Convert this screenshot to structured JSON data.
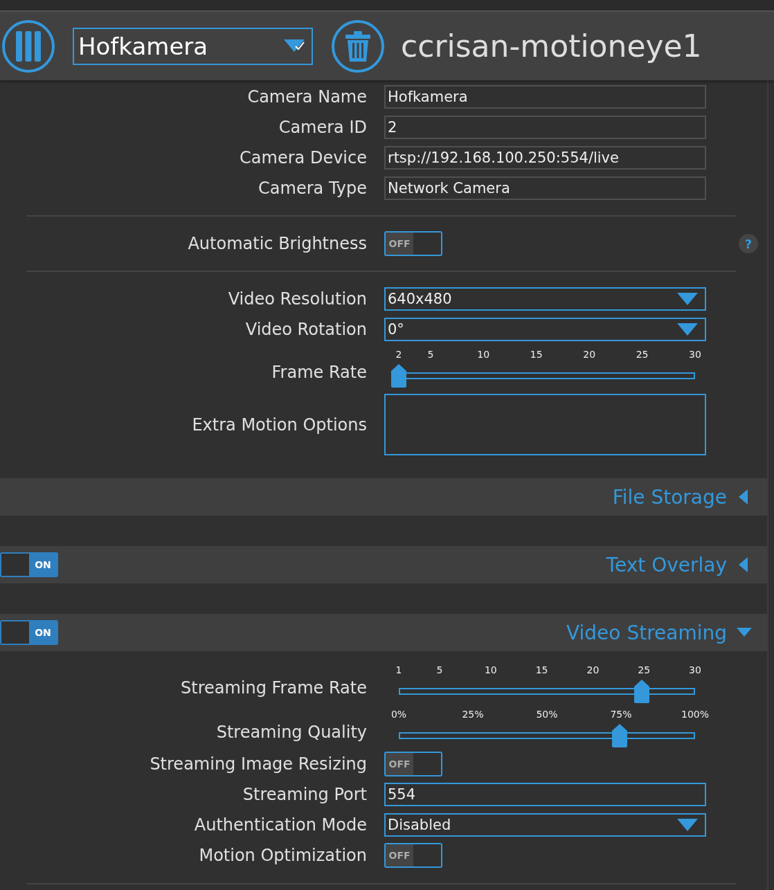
{
  "header": {
    "camera_select": "Hofkamera",
    "title": "ccrisan-motioneye1"
  },
  "general": {
    "groups": [
      [
        {
          "kind": "text",
          "label": "Camera Name",
          "value": "Hofkamera"
        },
        {
          "kind": "text",
          "label": "Camera ID",
          "value": "2"
        },
        {
          "kind": "text",
          "label": "Camera Device",
          "value": "rtsp://192.168.100.250:554/live"
        },
        {
          "kind": "text",
          "label": "Camera Type",
          "value": "Network Camera"
        }
      ],
      [
        {
          "kind": "toggle",
          "label": "Automatic Brightness",
          "on": false,
          "state_text": "OFF",
          "help": "?"
        }
      ],
      [
        {
          "kind": "select",
          "label": "Video Resolution",
          "value": "640x480"
        },
        {
          "kind": "select",
          "label": "Video Rotation",
          "value": "0°"
        },
        {
          "kind": "slider",
          "label": "Frame Rate",
          "level": 0,
          "ticks": [
            "2",
            "5",
            "10",
            "15",
            "20",
            "25",
            "30"
          ]
        },
        {
          "kind": "textarea",
          "label": "Extra Motion Options"
        }
      ]
    ]
  },
  "sections": [
    {
      "title": "File Storage",
      "expanded": false
    },
    {
      "title": "Text Overlay",
      "expanded": false,
      "toggle": {
        "on": true,
        "state_text": "ON"
      }
    },
    {
      "title": "Video Streaming",
      "expanded": true,
      "toggle": {
        "on": true,
        "state_text": "ON"
      },
      "rows": [
        {
          "kind": "slider",
          "label": "Streaming Frame Rate",
          "level": 0.82,
          "ticks": [
            "1",
            "5",
            "10",
            "15",
            "20",
            "25",
            "30"
          ]
        },
        {
          "kind": "slider",
          "label": "Streaming Quality",
          "level": 0.745,
          "ticks": [
            "0%",
            "25%",
            "50%",
            "75%",
            "100%"
          ]
        },
        {
          "kind": "toggle",
          "label": "Streaming Image Resizing",
          "on": false,
          "state_text": "OFF"
        },
        {
          "kind": "text",
          "label": "Streaming Port",
          "value": "554"
        },
        {
          "kind": "select",
          "label": "Authentication Mode",
          "value": "Disabled"
        },
        {
          "kind": "toggle",
          "label": "Motion Optimization",
          "on": false,
          "state_text": "OFF"
        }
      ]
    }
  ]
}
